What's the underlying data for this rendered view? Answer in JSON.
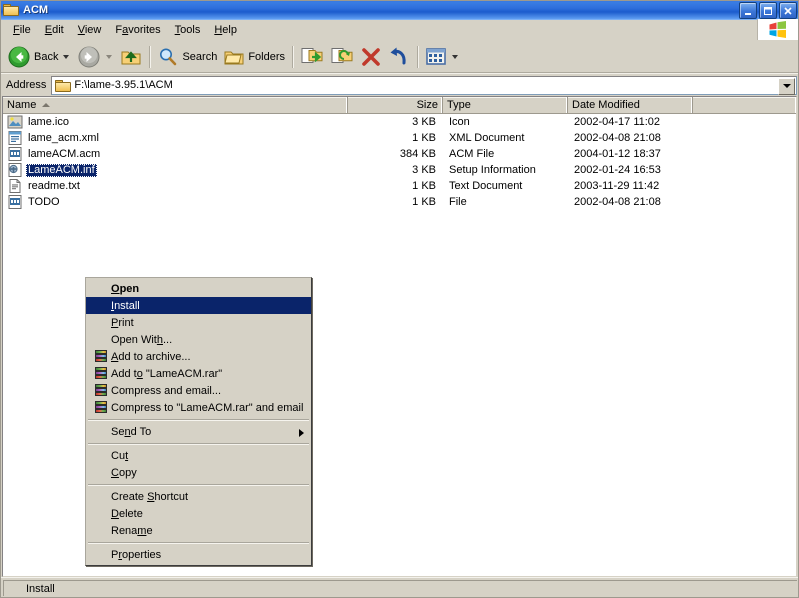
{
  "window": {
    "title": "ACM",
    "title_icon": "folder-icon",
    "buttons": {
      "minimize": "minimize-button",
      "maximize": "maximize-button",
      "close": "close-button"
    }
  },
  "menubar": {
    "items": [
      {
        "label": "File",
        "accel": "F"
      },
      {
        "label": "Edit",
        "accel": "E"
      },
      {
        "label": "View",
        "accel": "V"
      },
      {
        "label": "Favorites",
        "accel": "a"
      },
      {
        "label": "Tools",
        "accel": "T"
      },
      {
        "label": "Help",
        "accel": "H"
      }
    ],
    "brand_icon": "windows-flag-icon"
  },
  "toolbar": {
    "back_label": "Back",
    "search_label": "Search",
    "folders_label": "Folders",
    "items": [
      {
        "name": "back-button",
        "icon": "arrow-left-green-icon",
        "label": "Back"
      },
      {
        "name": "forward-button",
        "icon": "arrow-right-gray-icon",
        "label": ""
      },
      {
        "name": "up-button",
        "icon": "folder-up-icon",
        "label": ""
      },
      {
        "name": "search-button",
        "icon": "search-icon",
        "label": "Search"
      },
      {
        "name": "folders-button",
        "icon": "folders-icon",
        "label": "Folders"
      },
      {
        "name": "move-to-button",
        "icon": "move-to-folder-icon",
        "label": ""
      },
      {
        "name": "copy-to-button",
        "icon": "copy-to-folder-icon",
        "label": ""
      },
      {
        "name": "delete-button",
        "icon": "delete-x-icon",
        "label": ""
      },
      {
        "name": "undo-button",
        "icon": "undo-arrow-icon",
        "label": ""
      },
      {
        "name": "views-button",
        "icon": "views-icon",
        "label": ""
      }
    ]
  },
  "address": {
    "label": "Address",
    "value": "F:\\lame-3.95.1\\ACM",
    "icon": "folder-icon",
    "dropdown_icon": "chevron-down-icon"
  },
  "filelist": {
    "columns": [
      {
        "key": "name",
        "label": "Name",
        "sorted": true,
        "sort_dir": "asc"
      },
      {
        "key": "size",
        "label": "Size"
      },
      {
        "key": "type",
        "label": "Type"
      },
      {
        "key": "date",
        "label": "Date Modified"
      }
    ],
    "rows": [
      {
        "name": "lame.ico",
        "size": "3 KB",
        "type": "Icon",
        "date": "2002-04-17 11:02",
        "icon": "ico-file-icon",
        "selected": false
      },
      {
        "name": "lame_acm.xml",
        "size": "1 KB",
        "type": "XML Document",
        "date": "2002-04-08 21:08",
        "icon": "xml-file-icon",
        "selected": false
      },
      {
        "name": "lameACM.acm",
        "size": "384 KB",
        "type": "ACM File",
        "date": "2004-01-12 18:37",
        "icon": "acm-file-icon",
        "selected": false
      },
      {
        "name": "LameACM.inf",
        "size": "3 KB",
        "type": "Setup Information",
        "date": "2002-01-24 16:53",
        "icon": "inf-file-icon",
        "selected": true
      },
      {
        "name": "readme.txt",
        "size": "1 KB",
        "type": "Text Document",
        "date": "2003-11-29 11:42",
        "icon": "text-file-icon",
        "selected": false
      },
      {
        "name": "TODO",
        "size": "1 KB",
        "type": "File",
        "date": "2002-04-08 21:08",
        "icon": "generic-file-icon",
        "selected": false
      }
    ]
  },
  "context_menu": {
    "items": [
      {
        "label": "Open",
        "accel": "O",
        "bold": true,
        "icon": null,
        "highlighted": false
      },
      {
        "label": "Install",
        "accel": "I",
        "bold": false,
        "icon": null,
        "highlighted": true
      },
      {
        "label": "Print",
        "accel": "P",
        "bold": false,
        "icon": null,
        "highlighted": false
      },
      {
        "label": "Open With...",
        "accel": "h",
        "bold": false,
        "icon": null,
        "highlighted": false
      },
      {
        "label": "Add to archive...",
        "accel": "A",
        "bold": false,
        "icon": "winrar-icon",
        "highlighted": false
      },
      {
        "label": "Add to \"LameACM.rar\"",
        "accel": "o",
        "bold": false,
        "icon": "winrar-icon",
        "highlighted": false
      },
      {
        "label": "Compress and email...",
        "accel": null,
        "bold": false,
        "icon": "winrar-icon",
        "highlighted": false
      },
      {
        "label": "Compress to \"LameACM.rar\" and email",
        "accel": null,
        "bold": false,
        "icon": "winrar-icon",
        "highlighted": false
      },
      {
        "separator": true
      },
      {
        "label": "Send To",
        "accel": "n",
        "bold": false,
        "icon": null,
        "highlighted": false,
        "submenu": true
      },
      {
        "separator": true
      },
      {
        "label": "Cut",
        "accel": "t",
        "bold": false,
        "icon": null,
        "highlighted": false
      },
      {
        "label": "Copy",
        "accel": "C",
        "bold": false,
        "icon": null,
        "highlighted": false
      },
      {
        "separator": true
      },
      {
        "label": "Create Shortcut",
        "accel": "S",
        "bold": false,
        "icon": null,
        "highlighted": false
      },
      {
        "label": "Delete",
        "accel": "D",
        "bold": false,
        "icon": null,
        "highlighted": false
      },
      {
        "label": "Rename",
        "accel": "m",
        "bold": false,
        "icon": null,
        "highlighted": false
      },
      {
        "separator": true
      },
      {
        "label": "Properties",
        "accel": "r",
        "bold": false,
        "icon": null,
        "highlighted": false
      }
    ]
  },
  "statusbar": {
    "text": "Install"
  },
  "colors": {
    "titlebar_start": "#1c5ccd",
    "titlebar_end": "#8fbcf6",
    "selection": "#0a246a",
    "face": "#d6d2c6",
    "listview_bg": "#ffffff"
  }
}
